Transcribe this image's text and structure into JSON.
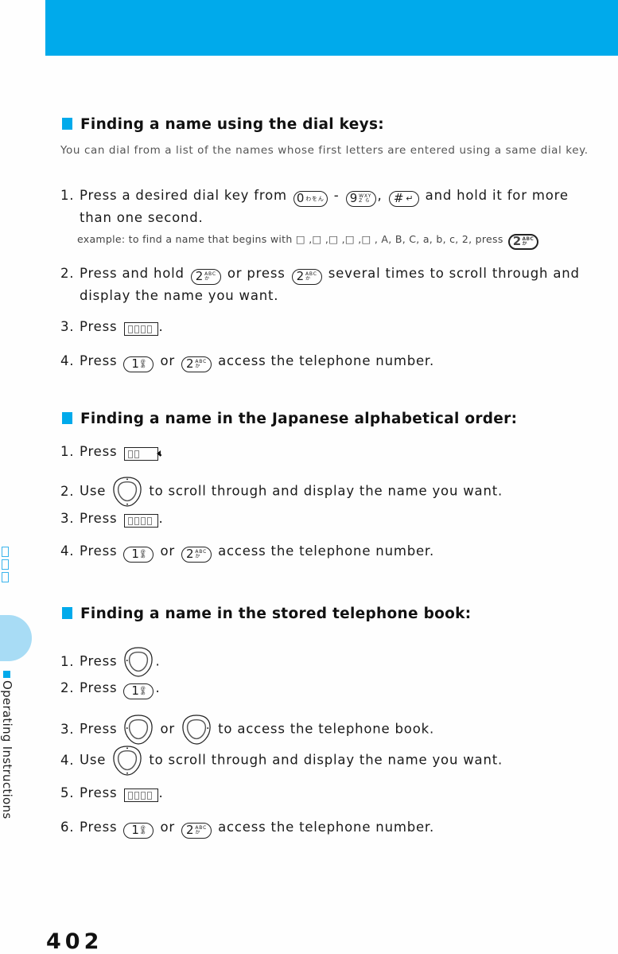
{
  "colors": {
    "accent": "#00aaeb",
    "tab": "#a8dcf5"
  },
  "sidebar": {
    "label": "Operating Instructions"
  },
  "page_number": "402",
  "section1": {
    "title": "Finding a name using the dial keys:",
    "intro": "You can dial from a list of the names whose first letters are entered using a same dial key.",
    "step1": {
      "num": "1.",
      "a": "Press a desired dial key from",
      "dash": "-",
      "comma": ",",
      "b": "and hold it for more",
      "c": "than one second."
    },
    "example": {
      "a": "example: to find a name that begins with",
      "chars": "□ ,□ ,□ ,□ ,□ , A, B, C, a, b, c, 2, press"
    },
    "step2": {
      "num": "2.",
      "a": "Press and hold",
      "b": "or press",
      "c": "several times to scroll through and",
      "d": "display the name you want."
    },
    "step3": {
      "num": "3.",
      "a": "Press",
      "end": "."
    },
    "step4": {
      "num": "4.",
      "a": "Press",
      "b": "or",
      "c": "access the telephone number."
    }
  },
  "section2": {
    "title": "Finding a name in the Japanese alphabetical order:",
    "step1": {
      "num": "1.",
      "a": "Press",
      "end": "."
    },
    "step2": {
      "num": "2.",
      "a": "Use",
      "b": "to scroll through and display the name you want."
    },
    "step3": {
      "num": "3.",
      "a": "Press",
      "end": "."
    },
    "step4": {
      "num": "4.",
      "a": "Press",
      "b": "or",
      "c": "access the telephone number."
    }
  },
  "section3": {
    "title": "Finding a name in the stored telephone book:",
    "step1": {
      "num": "1.",
      "a": "Press",
      "end": "."
    },
    "step2": {
      "num": "2.",
      "a": "Press",
      "end": "."
    },
    "step3": {
      "num": "3.",
      "a": "Press",
      "b": "or",
      "c": "to access the telephone book."
    },
    "step4": {
      "num": "4.",
      "a": "Use",
      "b": "to scroll through and display the name you want."
    },
    "step5": {
      "num": "5.",
      "a": "Press",
      "end": "."
    },
    "step6": {
      "num": "6.",
      "a": "Press",
      "b": "or",
      "c": "access the telephone number."
    }
  },
  "keys": {
    "k0": {
      "main": "0",
      "sub": "わをん"
    },
    "k9": {
      "main": "9",
      "sub": "WXYZ ら"
    },
    "khash": {
      "main": "#",
      "sub": "↵"
    },
    "k1": {
      "main": "1",
      "sub": "@ あ"
    },
    "k2": {
      "main": "2",
      "sub": "ABC か"
    }
  }
}
